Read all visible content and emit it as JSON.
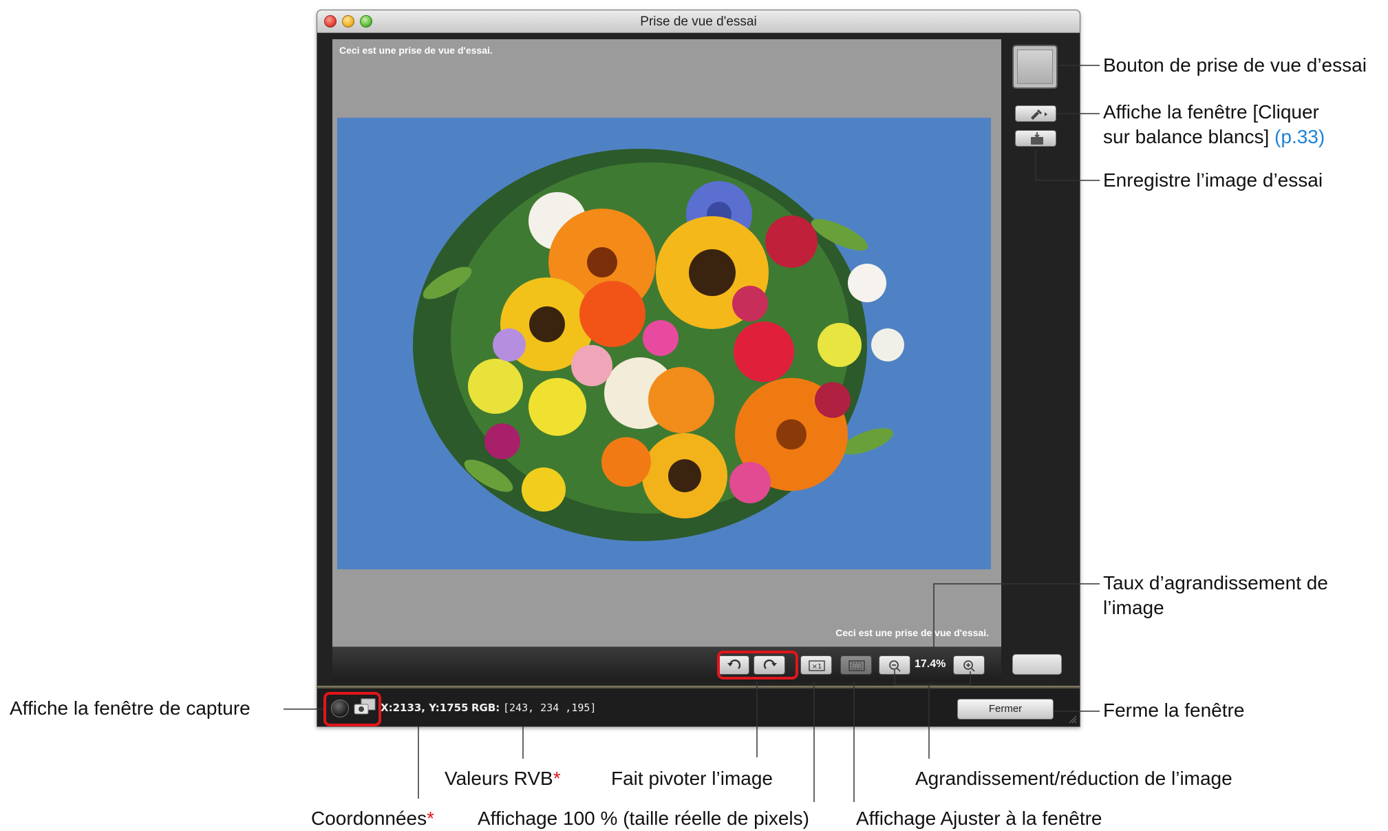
{
  "window": {
    "title": "Prise de vue d'essai",
    "caption_top": "Ceci est une prise de vue d'essai.",
    "caption_bottom": "Ceci est une prise de vue d'essai.",
    "zoom_value": "17.4%",
    "status": {
      "coords": "X:2133, Y:1755",
      "rgb_label": "RGB:",
      "rgb_value": "[243, 234 ,195]"
    },
    "close_label": "Fermer"
  },
  "annotations": {
    "test_shot_button": "Bouton de prise de vue d’essai",
    "wb_window_line1": "Affiche la fenêtre [Cliquer",
    "wb_window_line2": "sur balance blancs]",
    "wb_window_ref": "(p.33)",
    "save_test_image": "Enregistre l’image d’essai",
    "zoom_rate_line1": "Taux d’agrandissement de",
    "zoom_rate_line2": "l’image",
    "close_window": "Ferme la fenêtre",
    "capture_window": "Affiche la fenêtre de capture",
    "rgb_values": "Valeurs RVB",
    "rotate": "Fait pivoter l’image",
    "zoom_in_out": "Agrandissement/réduction de l’image",
    "coordinates": "Coordonnées",
    "display_100": "Affichage 100 % (taille réelle de pixels)",
    "fit_window": "Affichage Ajuster à la fenêtre",
    "asterisk": "*"
  },
  "colors": {
    "accent_red": "#e0161b",
    "link_blue": "#1b82d8",
    "photo_bg": "#4f82c4"
  },
  "icons": [
    "rotate-left-icon",
    "rotate-right-icon",
    "actual-size-icon",
    "fit-window-icon",
    "zoom-out-icon",
    "zoom-in-icon",
    "eyedropper-icon",
    "save-image-icon",
    "capture-window-icon",
    "capture-circle-icon",
    "resize-grip-icon"
  ]
}
